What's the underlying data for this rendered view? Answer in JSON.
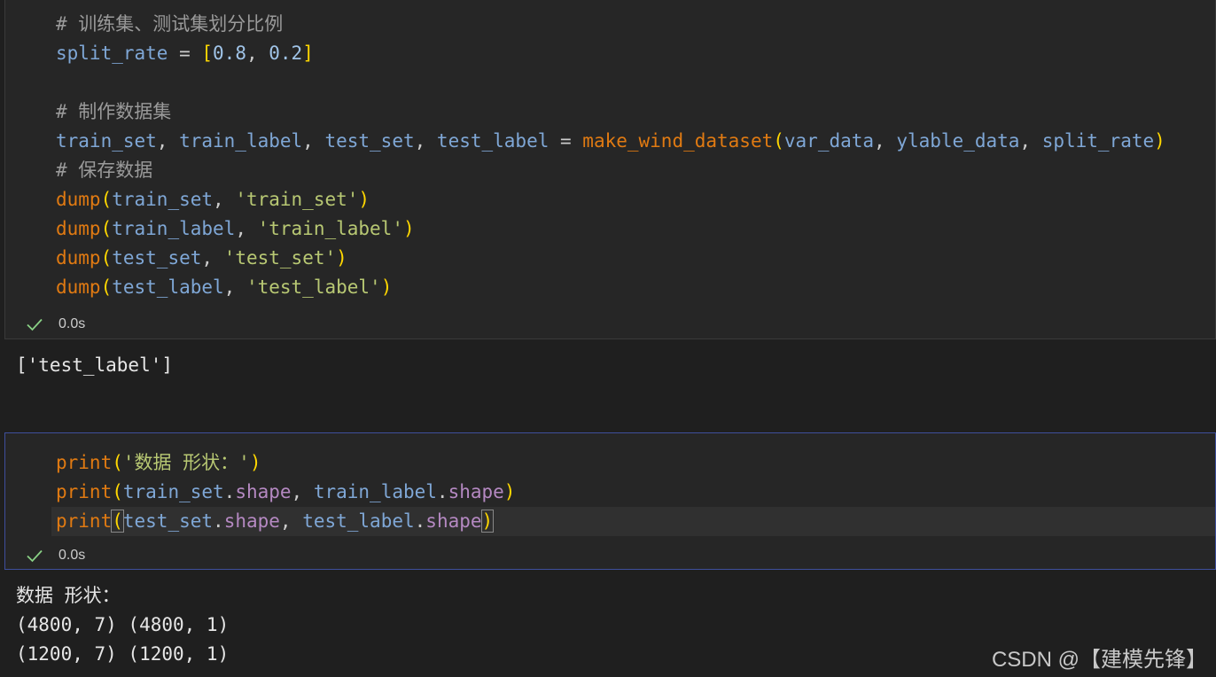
{
  "cell1": {
    "lines": [
      {
        "comment": "# 训练集、测试集划分比例"
      },
      {
        "var": "split_rate",
        "op": " = ",
        "open": "[",
        "n1": "0.8",
        "comma": ", ",
        "n2": "0.2",
        "close": "]"
      },
      {},
      {
        "comment": "# 制作数据集"
      },
      {
        "v1": "train_set",
        "c1": ", ",
        "v2": "train_label",
        "c2": ", ",
        "v3": "test_set",
        "c3": ", ",
        "v4": "test_label",
        "op": " = ",
        "func": "make_wind_dataset",
        "open": "(",
        "a1": "var_data",
        "c4": ", ",
        "a2": "ylable_data",
        "c5": ", ",
        "a3": "split_rate",
        "close": ")"
      },
      {
        "comment": "# 保存数据"
      },
      {
        "func": "dump",
        "open": "(",
        "arg": "train_set",
        "comma": ", ",
        "str": "'train_set'",
        "close": ")"
      },
      {
        "func": "dump",
        "open": "(",
        "arg": "train_label",
        "comma": ", ",
        "str": "'train_label'",
        "close": ")"
      },
      {
        "func": "dump",
        "open": "(",
        "arg": "test_set",
        "comma": ", ",
        "str": "'test_set'",
        "close": ")"
      },
      {
        "func": "dump",
        "open": "(",
        "arg": "test_label",
        "comma": ", ",
        "str": "'test_label'",
        "close": ")"
      }
    ],
    "status": {
      "time": "0.0s"
    },
    "output": [
      "['test_label']"
    ]
  },
  "cell2": {
    "lines": [
      {
        "func": "print",
        "open": "(",
        "str": "'数据 形状：'",
        "close": ")"
      },
      {
        "func": "print",
        "open": "(",
        "o1": "train_set",
        "dot1": ".",
        "a1": "shape",
        "comma": ", ",
        "o2": "train_label",
        "dot2": ".",
        "a2": "shape",
        "close": ")"
      },
      {
        "func": "print",
        "open": "(",
        "o1": "test_set",
        "dot1": ".",
        "a1": "shape",
        "comma": ", ",
        "o2": "test_label",
        "dot2": ".",
        "a2": "shape",
        "close": ")"
      }
    ],
    "status": {
      "time": "0.0s"
    },
    "output": [
      "数据 形状：",
      "(4800, 7) (4800, 1)",
      "(1200, 7) (1200, 1)"
    ]
  },
  "watermark": "CSDN @【建模先锋】",
  "colors": {
    "background": "#1f1f1f",
    "cell_background": "#262626",
    "comment": "#9a9a9a",
    "variable": "#7fa7d6",
    "function": "#e07a12",
    "string": "#b8c873",
    "attribute": "#b589c2",
    "bracket": "#ffd700",
    "success_check": "#89d185",
    "focused_cell_border": "#3e4f9c"
  },
  "icons": [
    "check-icon"
  ]
}
